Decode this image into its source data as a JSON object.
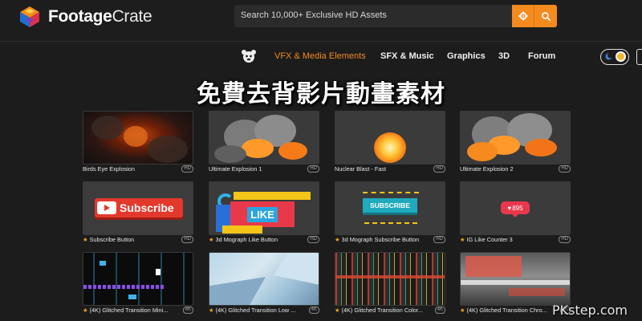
{
  "header": {
    "brand_bold": "Footage",
    "brand_light": "Crate",
    "search_placeholder": "Search 10,000+ Exclusive HD Assets",
    "accent": "#f58a1f"
  },
  "nav": {
    "items": [
      {
        "label": "VFX & Media Elements",
        "active": true
      },
      {
        "label": "SFX & Music"
      },
      {
        "label": "Graphics"
      },
      {
        "label": "3D"
      },
      {
        "label": "Forum"
      }
    ]
  },
  "overlay_caption": "免費去背影片動畫素材",
  "assets": [
    {
      "title": "Birds Eye Explosion",
      "badge": "HD",
      "premium": false
    },
    {
      "title": "Ultimate Explosion 1",
      "badge": "HD",
      "premium": false
    },
    {
      "title": "Nuclear Blast - Fast",
      "badge": "HD",
      "premium": false
    },
    {
      "title": "Ultimate Explosion 2",
      "badge": "HD",
      "premium": false
    },
    {
      "title": "Subscribe Button",
      "badge": "HD",
      "premium": true
    },
    {
      "title": "3d Mograph Like Button",
      "badge": "HD",
      "premium": true
    },
    {
      "title": "3d Mograph Subscribe Button",
      "badge": "HD",
      "premium": true
    },
    {
      "title": "IG Like Counter 3",
      "badge": "HD",
      "premium": true
    },
    {
      "title": "(4K) Glitched Transition Mini...",
      "badge": "4K",
      "premium": true
    },
    {
      "title": "(4K) Glitched Transition Low ...",
      "badge": "4K",
      "premium": true
    },
    {
      "title": "(4K) Glitched Transition Color...",
      "badge": "4K",
      "premium": true
    },
    {
      "title": "(4K) Glitched Transition Chro...",
      "badge": "4K",
      "premium": true
    }
  ],
  "thumb_text": {
    "subscribe": "Subscribe",
    "like": "LIKE",
    "subscribe_caps": "SUBSCRIBE",
    "ig_count": "895"
  },
  "watermark": "PKstep.com"
}
